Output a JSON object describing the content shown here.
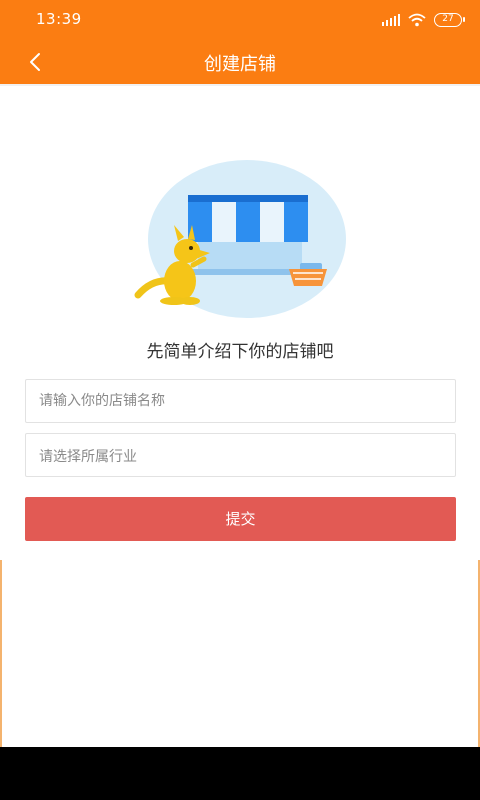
{
  "status_bar": {
    "time": "13:39",
    "battery": "27"
  },
  "header": {
    "title": "创建店铺",
    "back_icon": "chevron-left-icon"
  },
  "illustration": {
    "icon": "shop-kangaroo-illustration"
  },
  "intro_text": "先简单介绍下你的店铺吧",
  "form": {
    "shop_name_placeholder": "请输入你的店铺名称",
    "industry_placeholder": "请选择所属行业",
    "submit_label": "提交"
  },
  "colors": {
    "accent": "#fb7d12",
    "submit": "#e25a54"
  }
}
